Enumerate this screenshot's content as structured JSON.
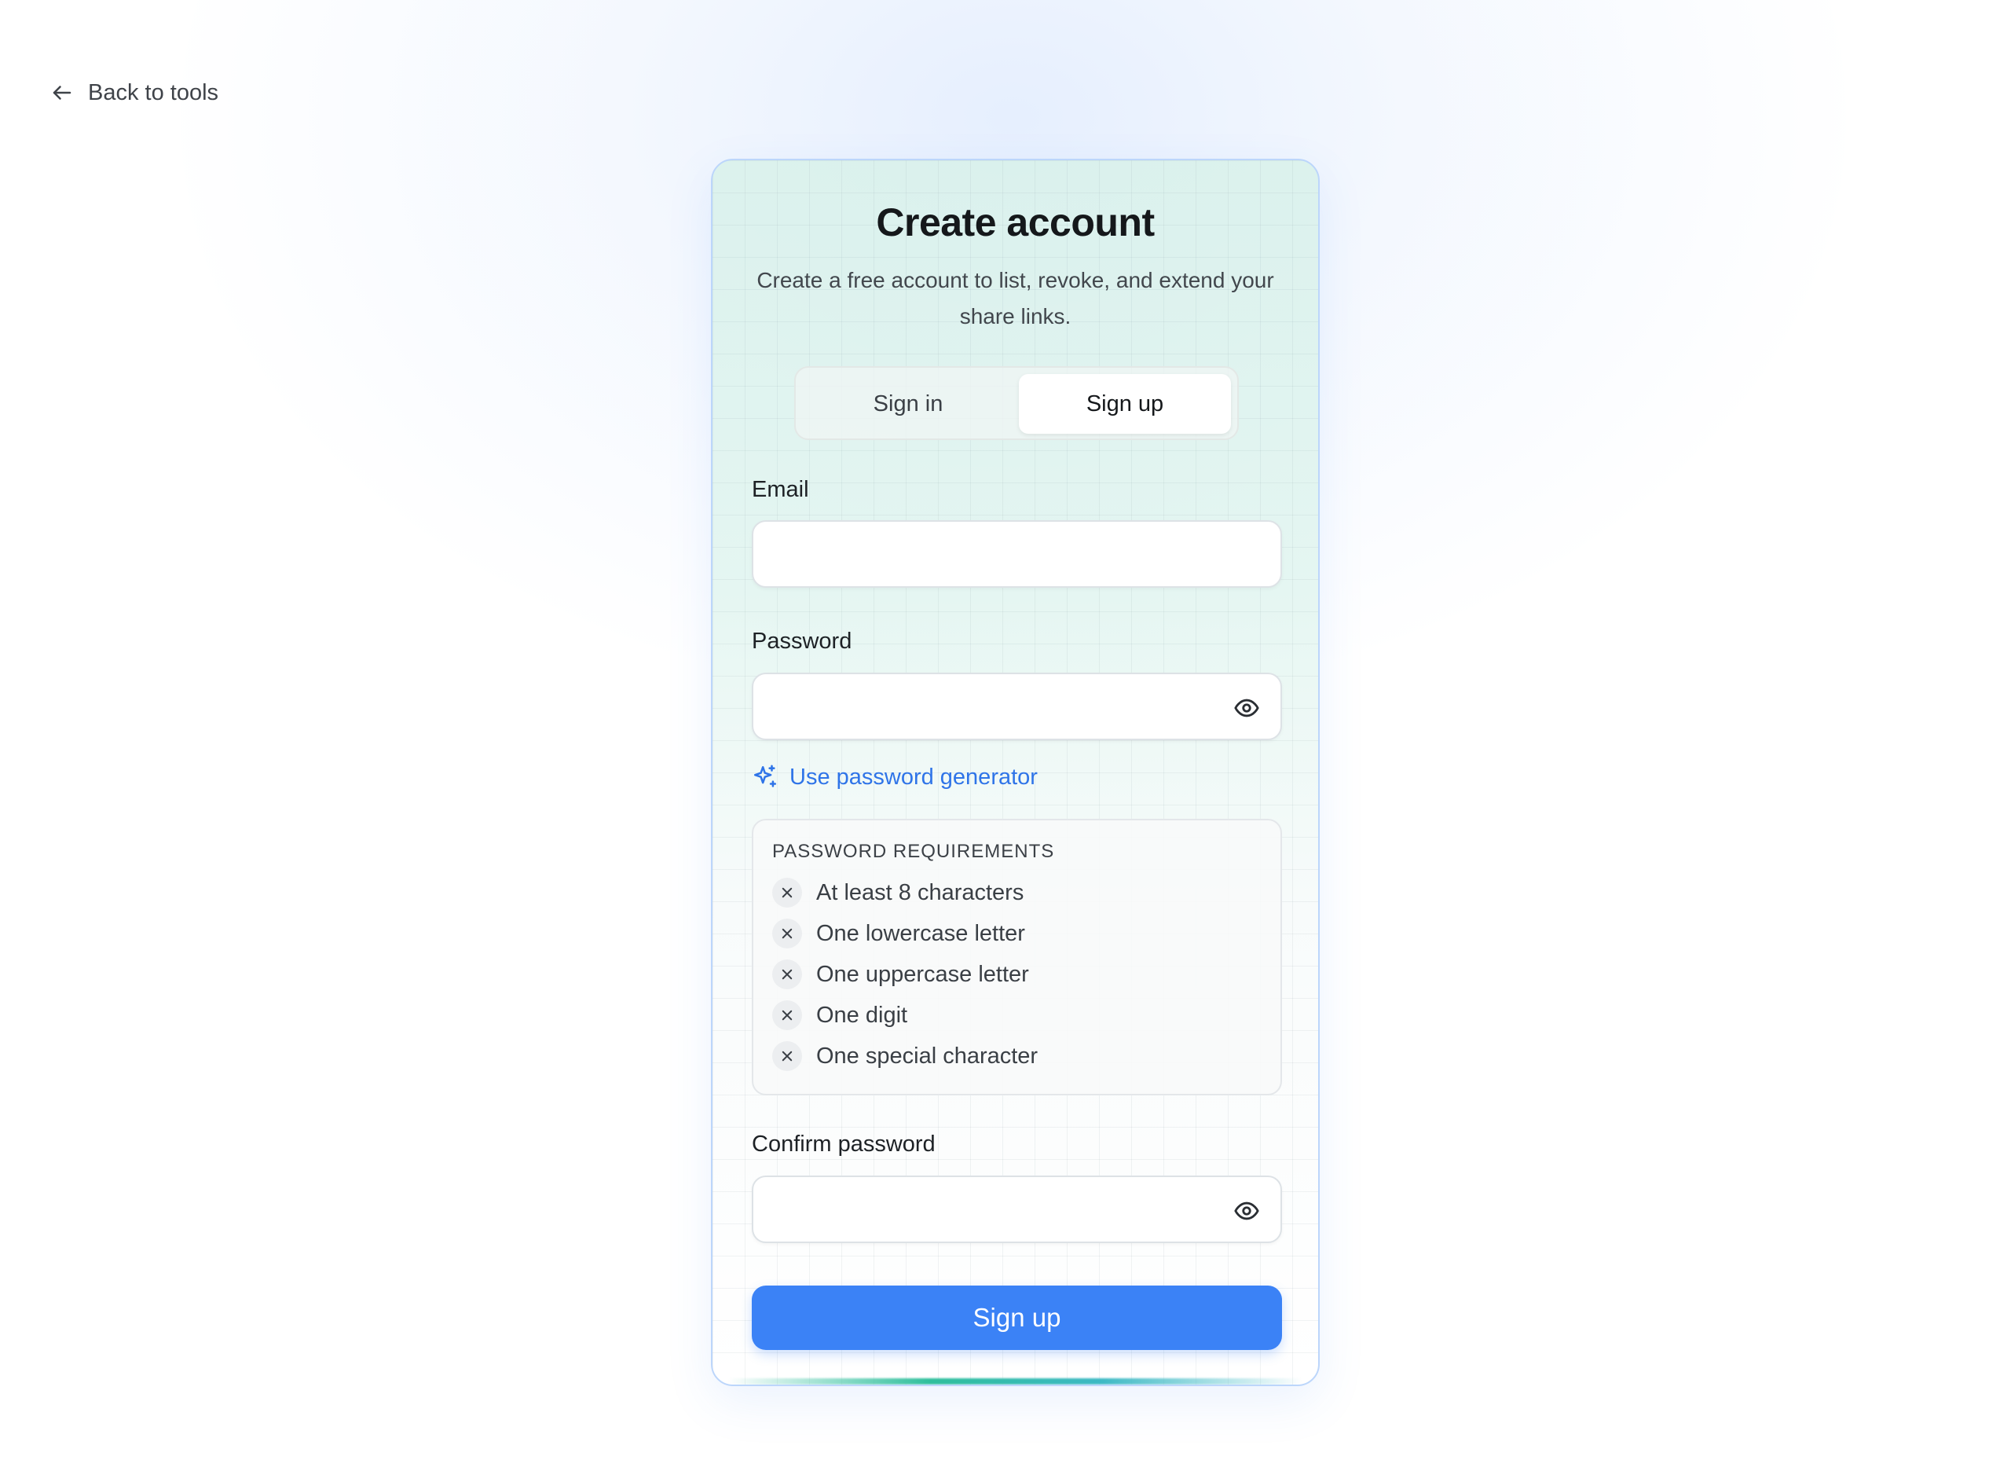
{
  "nav": {
    "back_label": "Back to tools",
    "back_icon": "arrow-left-icon"
  },
  "card": {
    "title": "Create account",
    "subtitle": "Create a free account to list, revoke, and extend your share links."
  },
  "tabs": [
    {
      "label": "Sign in",
      "active": false
    },
    {
      "label": "Sign up",
      "active": true
    }
  ],
  "form": {
    "email": {
      "label": "Email",
      "value": "",
      "placeholder": ""
    },
    "password": {
      "label": "Password",
      "value": "",
      "placeholder": "",
      "toggle_icon": "eye-icon"
    },
    "generator": {
      "label": "Use password generator",
      "icon": "sparkles-icon",
      "color": "#2f74e8"
    },
    "requirements": {
      "title": "PASSWORD REQUIREMENTS",
      "items": [
        {
          "label": "At least 8 characters",
          "met": false
        },
        {
          "label": "One lowercase letter",
          "met": false
        },
        {
          "label": "One uppercase letter",
          "met": false
        },
        {
          "label": "One digit",
          "met": false
        },
        {
          "label": "One special character",
          "met": false
        }
      ]
    },
    "confirm_password": {
      "label": "Confirm password",
      "value": "",
      "placeholder": "",
      "toggle_icon": "eye-icon"
    },
    "submit_label": "Sign up"
  },
  "colors": {
    "accent": "#3b82f6",
    "link": "#2f74e8",
    "card_border": "#bcd6fb"
  }
}
